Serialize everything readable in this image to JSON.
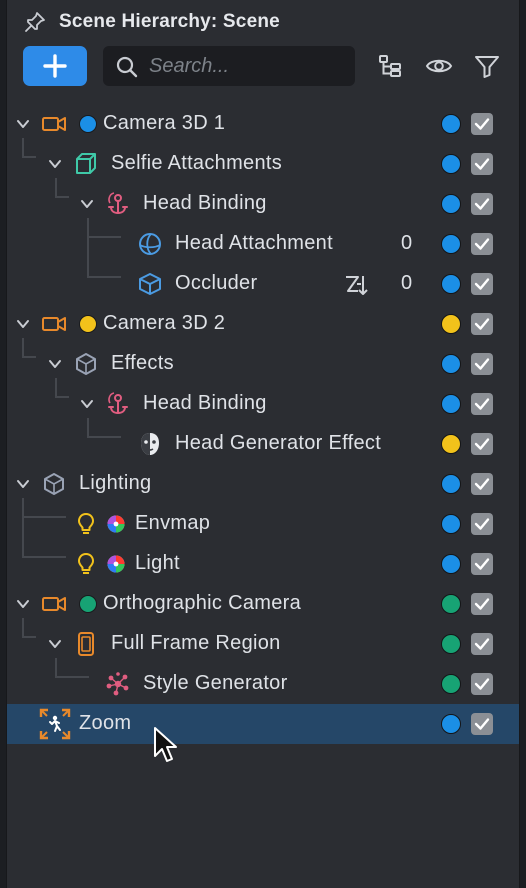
{
  "header": {
    "title": "Scene Hierarchy: Scene",
    "pin_icon": "pin-icon"
  },
  "toolbar": {
    "add_icon": "plus-icon",
    "search_placeholder": "Search...",
    "search_value": "",
    "icons": [
      "hierarchy-icon",
      "eye-icon",
      "filter-icon"
    ]
  },
  "tree": [
    {
      "label": "Camera 3D 1",
      "icon": "camera-icon",
      "dot": "#1b8fe6",
      "layer": "#1b8fe6",
      "checked": true
    },
    {
      "label": "Selfie Attachments",
      "icon": "cube-icon",
      "layer": "#1b8fe6",
      "checked": true
    },
    {
      "label": "Head Binding",
      "icon": "anchor-icon",
      "layer": "#1b8fe6",
      "checked": true
    },
    {
      "label": "Head Attachment",
      "icon": "sphere-icon",
      "count": "0",
      "layer": "#1b8fe6",
      "checked": true
    },
    {
      "label": "Occluder",
      "icon": "box-icon",
      "extra_icon": "sort-icon",
      "count": "0",
      "layer": "#1b8fe6",
      "checked": true
    },
    {
      "label": "Camera 3D 2",
      "icon": "camera-icon",
      "dot": "#f2c21b",
      "layer": "#f2c21b",
      "checked": true
    },
    {
      "label": "Effects",
      "icon": "effects-icon",
      "layer": "#1b8fe6",
      "checked": true
    },
    {
      "label": "Head Binding",
      "icon": "anchor-icon",
      "layer": "#1b8fe6",
      "checked": true
    },
    {
      "label": "Head Generator Effect",
      "icon": "face-mask-icon",
      "layer": "#f2c21b",
      "checked": true
    },
    {
      "label": "Lighting",
      "icon": "effects-icon",
      "layer": "#1b8fe6",
      "checked": true
    },
    {
      "label": "Envmap",
      "icon": "bulb-icon",
      "dot_icon": "color-wheel-icon",
      "layer": "#1b8fe6",
      "checked": true
    },
    {
      "label": "Light",
      "icon": "bulb-icon",
      "dot_icon": "color-wheel-icon",
      "layer": "#1b8fe6",
      "checked": true
    },
    {
      "label": "Orthographic Camera",
      "icon": "camera-icon",
      "dot": "#17a374",
      "layer": "#17a374",
      "checked": true
    },
    {
      "label": "Full Frame Region",
      "icon": "phone-frame-icon",
      "layer": "#17a374",
      "checked": true
    },
    {
      "label": "Style Generator",
      "icon": "style-gen-icon",
      "layer": "#17a374",
      "checked": true
    },
    {
      "label": "Zoom",
      "icon": "zoom-person-icon",
      "layer": "#1b8fe6",
      "checked": true,
      "selected": true
    }
  ],
  "colors": {
    "accent": "#2e8be8",
    "selection": "#254768",
    "orange": "#e8892b",
    "teal": "#3fc9a8",
    "pink": "#e05d80",
    "blue_icon": "#4b9be3",
    "gray_icon": "#9aa3b5",
    "yellow_icon": "#f2c21b"
  }
}
